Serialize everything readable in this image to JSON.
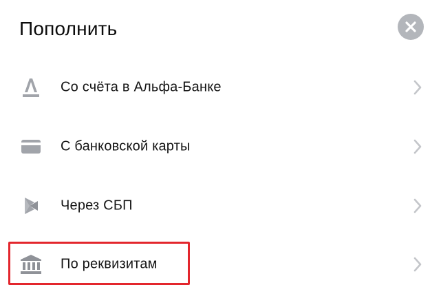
{
  "header": {
    "title": "Пополнить",
    "close_icon": "close-icon"
  },
  "menu": {
    "items": [
      {
        "label": "Со счёта в Альфа-Банке",
        "icon": "alfa-bank-logo-icon"
      },
      {
        "label": "С банковской карты",
        "icon": "bank-card-icon"
      },
      {
        "label": "Через СБП",
        "icon": "sbp-icon"
      },
      {
        "label": "По реквизитам",
        "icon": "bank-building-icon"
      }
    ]
  },
  "colors": {
    "icon": "#a1a4aa",
    "chevron": "#c4c6ca",
    "close_bg": "#b3b6bb",
    "highlight": "#e3262d"
  }
}
